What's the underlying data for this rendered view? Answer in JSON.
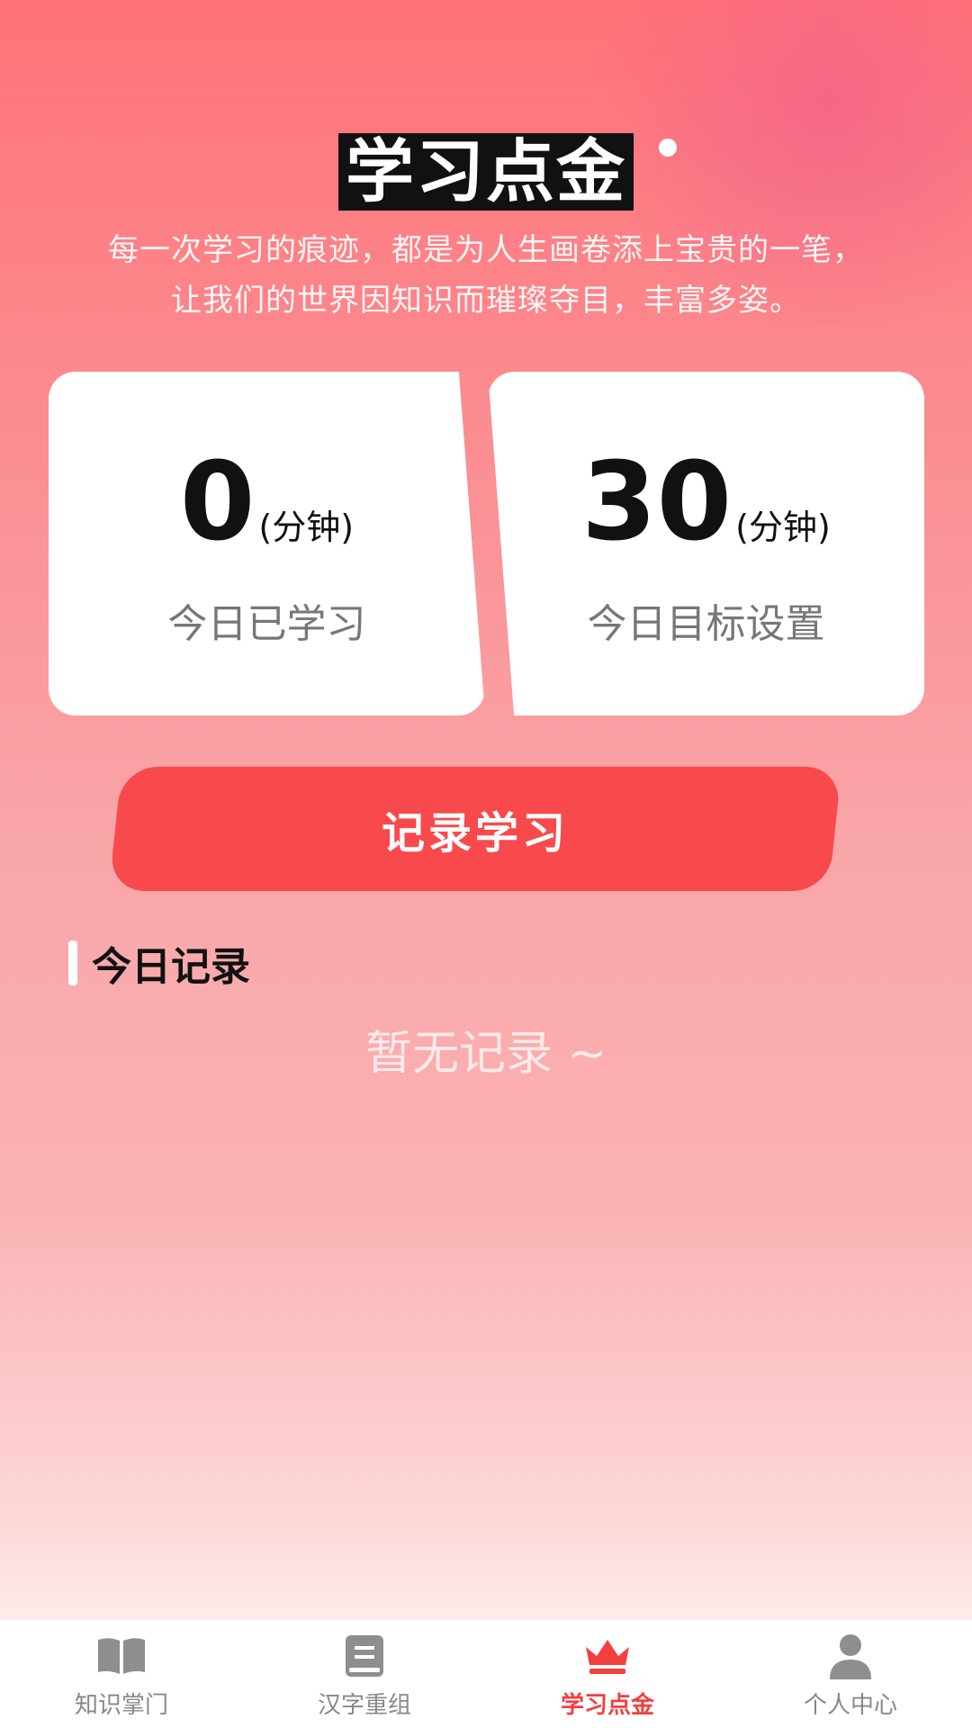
{
  "header": {
    "title": "学习点金",
    "subtitle_line1": "每一次学习的痕迹，都是为人生画卷添上宝贵的一笔，",
    "subtitle_line2": "让我们的世界因知识而璀璨夺目，丰富多姿。"
  },
  "stats": {
    "studied": {
      "value": "0",
      "unit": "(分钟)",
      "label": "今日已学习"
    },
    "goal": {
      "value": "30",
      "unit": "(分钟)",
      "label": "今日目标设置"
    }
  },
  "record_button_label": "记录学习",
  "today": {
    "title": "今日记录",
    "empty_text": "暂无记录 ~"
  },
  "tabbar": {
    "items": [
      {
        "label": "知识掌门",
        "icon": "book-open-icon"
      },
      {
        "label": "汉字重组",
        "icon": "book-closed-icon"
      },
      {
        "label": "学习点金",
        "icon": "crown-icon",
        "active": true
      },
      {
        "label": "个人中心",
        "icon": "person-icon"
      }
    ]
  },
  "colors": {
    "accent": "#f84a4c",
    "active_tab": "#f43f3f",
    "inactive_tab": "#888888"
  }
}
